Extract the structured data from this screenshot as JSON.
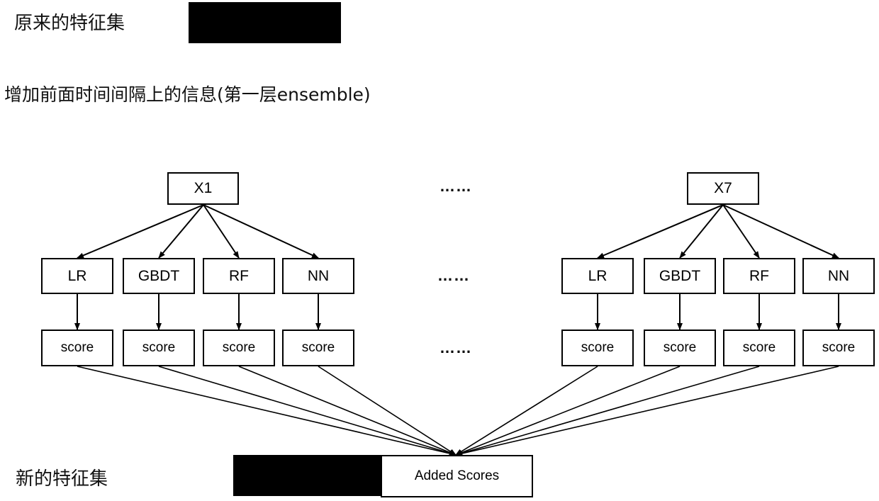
{
  "labels": {
    "original_feature_set": "原来的特征集",
    "layer_title": "增加前面时间间隔上的信息(第一层ensemble)",
    "new_feature_set": "新的特征集",
    "added_scores": "Added Scores",
    "ellipsis": "……"
  },
  "groups": [
    {
      "input": "X1",
      "models": [
        "LR",
        "GBDT",
        "RF",
        "NN"
      ],
      "outputs": [
        "score",
        "score",
        "score",
        "score"
      ]
    },
    {
      "input": "X7",
      "models": [
        "LR",
        "GBDT",
        "RF",
        "NN"
      ],
      "outputs": [
        "score",
        "score",
        "score",
        "score"
      ]
    }
  ]
}
